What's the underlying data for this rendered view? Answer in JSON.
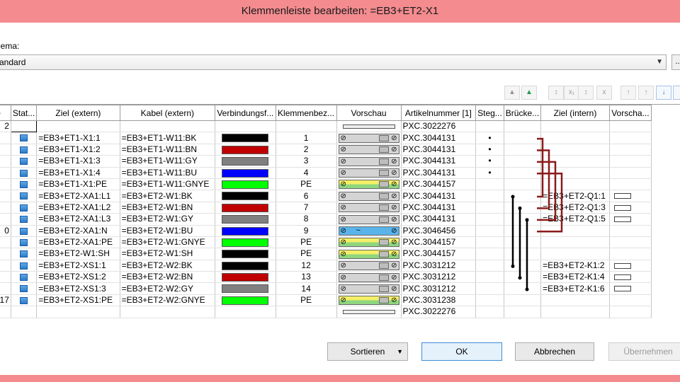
{
  "window": {
    "title": "Klemmenleiste bearbeiten: =EB3+ET2-X1"
  },
  "schema": {
    "label": "hema:",
    "value": "andard",
    "extra_label": "..."
  },
  "toolbar": {
    "icons": [
      "move-up-icon",
      "underline-icon",
      "sort-icon",
      "x1-icon",
      "sort-down-icon",
      "x-icon",
      "move-top-icon",
      "arrow-up-icon",
      "arrow-down-icon",
      "move-bottom-icon"
    ]
  },
  "columns": [
    "Zeile",
    "Stat...",
    "Ziel (extern)",
    "Kabel (extern)",
    "Verbindungsf...",
    "Klemmenbez...",
    "Vorschau",
    "Artikelnummer [1]",
    "Steg...",
    "Brücke...",
    "Ziel (intern)",
    "Vorscha..."
  ],
  "rows": [
    {
      "zeile": "2",
      "status": false,
      "ziel": "",
      "kabel": "",
      "color": "",
      "bez": "",
      "preview": "plate",
      "artikel": "PXC.3022276",
      "steg": "",
      "intern": "",
      "vorschau2": false
    },
    {
      "zeile": "",
      "status": true,
      "ziel": "=EB3+ET1-X1:1",
      "kabel": "=EB3+ET1-W11:BK",
      "color": "#000000",
      "bez": "1",
      "preview": "grey",
      "artikel": "PXC.3044131",
      "steg": "•",
      "intern": "",
      "vorschau2": false
    },
    {
      "zeile": "",
      "status": true,
      "ziel": "=EB3+ET1-X1:2",
      "kabel": "=EB3+ET1-W11:BN",
      "color": "#c00000",
      "bez": "2",
      "preview": "grey",
      "artikel": "PXC.3044131",
      "steg": "•",
      "intern": "",
      "vorschau2": false
    },
    {
      "zeile": "",
      "status": true,
      "ziel": "=EB3+ET1-X1:3",
      "kabel": "=EB3+ET1-W11:GY",
      "color": "#808080",
      "bez": "3",
      "preview": "grey",
      "artikel": "PXC.3044131",
      "steg": "•",
      "intern": "",
      "vorschau2": false
    },
    {
      "zeile": "",
      "status": true,
      "ziel": "=EB3+ET1-X1:4",
      "kabel": "=EB3+ET1-W11:BU",
      "color": "#0000ff",
      "bez": "4",
      "preview": "grey",
      "artikel": "PXC.3044131",
      "steg": "•",
      "intern": "",
      "vorschau2": false
    },
    {
      "zeile": "",
      "status": true,
      "ziel": "=EB3+ET1-X1:PE",
      "kabel": "=EB3+ET1-W11:GNYE",
      "color": "#00ff00",
      "bez": "PE",
      "preview": "pe",
      "artikel": "PXC.3044157",
      "steg": "",
      "intern": "",
      "vorschau2": false
    },
    {
      "zeile": "",
      "status": true,
      "ziel": "=EB3+ET2-XA1:L1",
      "kabel": "=EB3+ET2-W1:BK",
      "color": "#000000",
      "bez": "6",
      "preview": "grey",
      "artikel": "PXC.3044131",
      "steg": "",
      "intern": "=EB3+ET2-Q1:1",
      "vorschau2": true
    },
    {
      "zeile": "",
      "status": true,
      "ziel": "=EB3+ET2-XA1:L2",
      "kabel": "=EB3+ET2-W1:BN",
      "color": "#c00000",
      "bez": "7",
      "preview": "grey",
      "artikel": "PXC.3044131",
      "steg": "",
      "intern": "=EB3+ET2-Q1:3",
      "vorschau2": true
    },
    {
      "zeile": "",
      "status": true,
      "ziel": "=EB3+ET2-XA1:L3",
      "kabel": "=EB3+ET2-W1:GY",
      "color": "#808080",
      "bez": "8",
      "preview": "grey",
      "artikel": "PXC.3044131",
      "steg": "",
      "intern": "=EB3+ET2-Q1:5",
      "vorschau2": true
    },
    {
      "zeile": "0",
      "status": true,
      "ziel": "=EB3+ET2-XA1:N",
      "kabel": "=EB3+ET2-W1:BU",
      "color": "#0000ff",
      "bez": "9",
      "preview": "blue",
      "artikel": "PXC.3046456",
      "steg": "",
      "intern": "",
      "vorschau2": false
    },
    {
      "zeile": "",
      "status": true,
      "ziel": "=EB3+ET2-XA1:PE",
      "kabel": "=EB3+ET2-W1:GNYE",
      "color": "#00ff00",
      "bez": "PE",
      "preview": "pe",
      "artikel": "PXC.3044157",
      "steg": "",
      "intern": "",
      "vorschau2": false
    },
    {
      "zeile": "",
      "status": true,
      "ziel": "=EB3+ET2-W1:SH",
      "kabel": "=EB3+ET2-W1:SH",
      "color": "#000000",
      "bez": "PE",
      "preview": "pe",
      "artikel": "PXC.3044157",
      "steg": "",
      "intern": "",
      "vorschau2": false
    },
    {
      "zeile": "",
      "status": true,
      "ziel": "=EB3+ET2-XS1:1",
      "kabel": "=EB3+ET2-W2:BK",
      "color": "#000000",
      "bez": "12",
      "preview": "grey",
      "artikel": "PXC.3031212",
      "steg": "",
      "intern": "=EB3+ET2-K1:2",
      "vorschau2": true
    },
    {
      "zeile": "",
      "status": true,
      "ziel": "=EB3+ET2-XS1:2",
      "kabel": "=EB3+ET2-W2:BN",
      "color": "#c00000",
      "bez": "13",
      "preview": "grey",
      "artikel": "PXC.3031212",
      "steg": "",
      "intern": "=EB3+ET2-K1:4",
      "vorschau2": true
    },
    {
      "zeile": "",
      "status": true,
      "ziel": "=EB3+ET2-XS1:3",
      "kabel": "=EB3+ET2-W2:GY",
      "color": "#808080",
      "bez": "14",
      "preview": "grey",
      "artikel": "PXC.3031212",
      "steg": "",
      "intern": "=EB3+ET2-K1:6",
      "vorschau2": true
    },
    {
      "zeile": ", 17",
      "status": true,
      "ziel": "=EB3+ET2-XS1:PE",
      "kabel": "=EB3+ET2-W2:GNYE",
      "color": "#00ff00",
      "bez": "PE",
      "preview": "pe",
      "artikel": "PXC.3031238",
      "steg": "",
      "intern": "",
      "vorschau2": false
    },
    {
      "zeile": "",
      "status": false,
      "ziel": "",
      "kabel": "",
      "color": "",
      "bez": "",
      "preview": "plate",
      "artikel": "PXC.3022276",
      "steg": "",
      "intern": "",
      "vorschau2": false
    }
  ],
  "buttons": {
    "sort": "Sortieren",
    "ok": "OK",
    "cancel": "Abbrechen",
    "apply": "Übernehmen"
  },
  "colors": {
    "title_bar": "#f38b8f",
    "bridge": "#8b1a1a",
    "steg_line": "#000000"
  }
}
